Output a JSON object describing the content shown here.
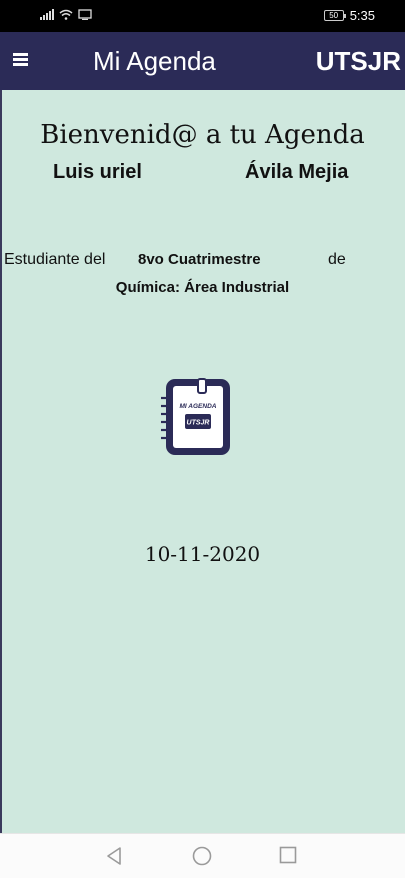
{
  "status_bar": {
    "time": "5:35",
    "battery": "50",
    "icons": [
      "signal-icon",
      "wifi-icon",
      "cast-icon",
      "battery-icon"
    ]
  },
  "app_bar": {
    "menu_icon": "hamburger-menu-icon",
    "title": "Mi Agenda",
    "brand": "UTSJR"
  },
  "profile": {
    "welcome": "Bienvenid@ a tu Agenda",
    "first_name": "Luis uriel",
    "last_name": "Ávila Mejia",
    "student_label": "Estudiante del",
    "semester": "8vo Cuatrimestre",
    "connector": "de",
    "career": "Química: Área Industrial",
    "date": "10-11-2020"
  },
  "logo": {
    "line1": "MI AGENDA",
    "line2": "UTSJR"
  },
  "nav_bar": {
    "icons": [
      "back-icon",
      "home-icon",
      "recents-icon"
    ]
  },
  "colors": {
    "app_bar": "#2b2b57",
    "content_bg": "#cfe8de",
    "logo": "#2b2b57"
  }
}
